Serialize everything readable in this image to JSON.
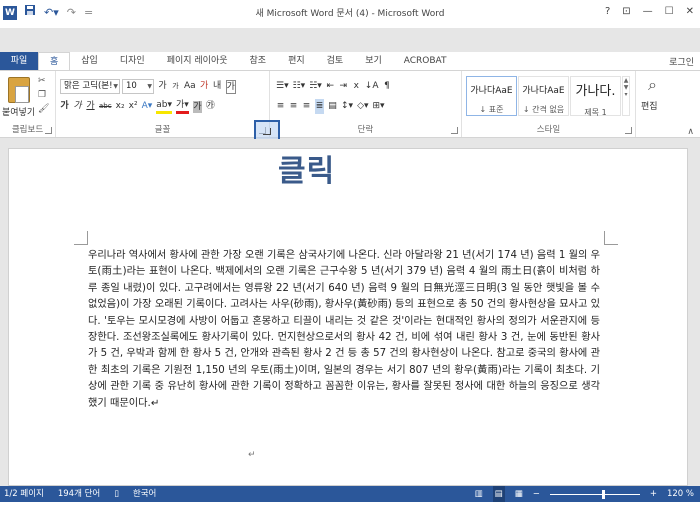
{
  "titlebar": {
    "app_icon": "W",
    "save_icon": "save-icon",
    "undo_label": "↶▾",
    "redo_label": "↷",
    "qat_more": "=",
    "title": "새 Microsoft Word 문서 (4) - Microsoft Word",
    "help_label": "?",
    "ribbon_opt_label": "⊡",
    "minimize_label": "—",
    "restore_label": "☐",
    "close_label": "✕"
  },
  "user": "로그인",
  "tabs": {
    "file": "파일",
    "items": [
      "홈",
      "삽입",
      "디자인",
      "페이지 레이아웃",
      "참조",
      "편지",
      "검토",
      "보기",
      "ACROBAT"
    ],
    "active_index": 0
  },
  "ribbon": {
    "clipboard": {
      "paste_label": "붙여넣기",
      "group_label": "클립보드"
    },
    "font": {
      "font_name": "맑은 고딕(본!",
      "font_size": "10",
      "grow": "가",
      "shrink": "가",
      "case": "Aa",
      "clear": "가",
      "format_box": "가",
      "bold": "가",
      "italic": "가",
      "underline": "가",
      "strike": "abc",
      "subscript": "x₂",
      "superscript": "x²",
      "group_label": "글꼴"
    },
    "paragraph": {
      "group_label": "단락"
    },
    "styles": {
      "items": [
        {
          "sample": "가나다AaE",
          "name": "↓ 표준"
        },
        {
          "sample": "가나다AaE",
          "name": "↓ 간격 없음"
        },
        {
          "sample": "가나다.",
          "name": "제목 1"
        }
      ],
      "group_label": "스타일"
    },
    "editing": {
      "label": "편집"
    }
  },
  "document": {
    "overlay_label": "클릭",
    "body": "우리나라 역사에서 황사에 관한 가장 오랜 기록은 삼국사기에 나온다. 신라 아달라왕 21 년(서기 174 년) 음력 1 월의 우토(雨土)라는 표현이 나온다. 백제에서의 오랜 기록은 근구수왕 5 년(서기 379 년) 음력 4 월의 雨土日(흙이 비처럼 하루 종일 내렸)이 있다. 고구려에서는 영류왕 22 년(서기 640 년) 음력 9 월의 日無光涇三日明(3 일 동안 햇빛을 볼 수 없었음)이 가장 오래된 기록이다. 고려사는 사우(砂雨), 황사우(黃砂雨) 등의 표현으로 총 50 건의 황사현상을 묘사고 있다. '토우는 모시모경에 사방이 어둡고 혼몽하고 티끌이 내리는 것 같은 것'이라는 현대적인 황사의 정의가 서운관지에 등장한다. 조선왕조실록에도 황사기록이 있다. 먼지현상으로서의 황사 42 건, 비에 섞여 내린 황사 3 건, 눈에 동반된 황사가 5 건, 우박과 함께 한 황사 5 건, 안개와 관측된 황사 2 건 등 총 57 건의 황사현상이 나온다. 참고로 중국의 황사에 관한 최초의 기록은 기원전 1,150 년의 우토(雨土)이며, 일본의 경우는 서기 807 년의 황우(黃雨)라는 기록이 최초다. 기상에 관한 기록 중 유난히 황사에 관한 기록이 정확하고 꼼꼼한 이유는, 황사를 잘못된 정사에 대한 하늘의 응징으로 생각했기 때문이다.↵",
    "para_mark": "↵"
  },
  "status": {
    "page": "1/2 페이지",
    "words": "194개 단어",
    "proof_icon": "proofing-icon",
    "language": "한국어",
    "zoom_minus": "−",
    "zoom_plus": "+",
    "zoom_level": "120 %",
    "zoom_fraction": 0.6
  }
}
